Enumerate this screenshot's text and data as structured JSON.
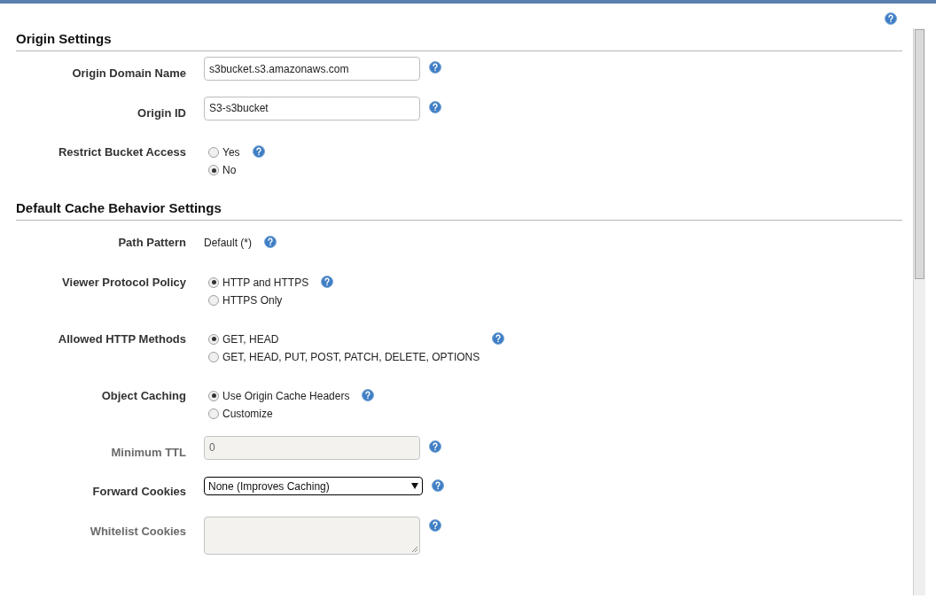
{
  "sections": [
    {
      "title": "Origin Settings",
      "fields": [
        {
          "kind": "text",
          "label": "Origin Domain Name",
          "value": "s3bucket.s3.amazonaws.com",
          "disabled": false
        },
        {
          "kind": "text",
          "label": "Origin ID",
          "value": "S3-s3bucket",
          "disabled": false
        },
        {
          "kind": "radio",
          "label": "Restrict Bucket Access",
          "options": [
            {
              "label": "Yes",
              "selected": false
            },
            {
              "label": "No",
              "selected": true
            }
          ]
        }
      ]
    },
    {
      "title": "Default Cache Behavior Settings",
      "fields": [
        {
          "kind": "static",
          "label": "Path Pattern",
          "value": "Default (*)"
        },
        {
          "kind": "radio",
          "label": "Viewer Protocol Policy",
          "options": [
            {
              "label": "HTTP and HTTPS",
              "selected": true
            },
            {
              "label": "HTTPS Only",
              "selected": false
            }
          ]
        },
        {
          "kind": "radio",
          "label": "Allowed HTTP Methods",
          "options": [
            {
              "label": "GET, HEAD",
              "selected": true
            },
            {
              "label": "GET, HEAD, PUT, POST, PATCH, DELETE, OPTIONS",
              "selected": false
            }
          ]
        },
        {
          "kind": "radio",
          "label": "Object Caching",
          "options": [
            {
              "label": "Use Origin Cache Headers",
              "selected": true
            },
            {
              "label": "Customize",
              "selected": false
            }
          ]
        },
        {
          "kind": "text",
          "label": "Minimum TTL",
          "value": "0",
          "disabled": true
        },
        {
          "kind": "select",
          "label": "Forward Cookies",
          "value": "None (Improves Caching)",
          "disabled": false
        },
        {
          "kind": "textarea",
          "label": "Whitelist Cookies",
          "disabled": true
        }
      ]
    }
  ]
}
